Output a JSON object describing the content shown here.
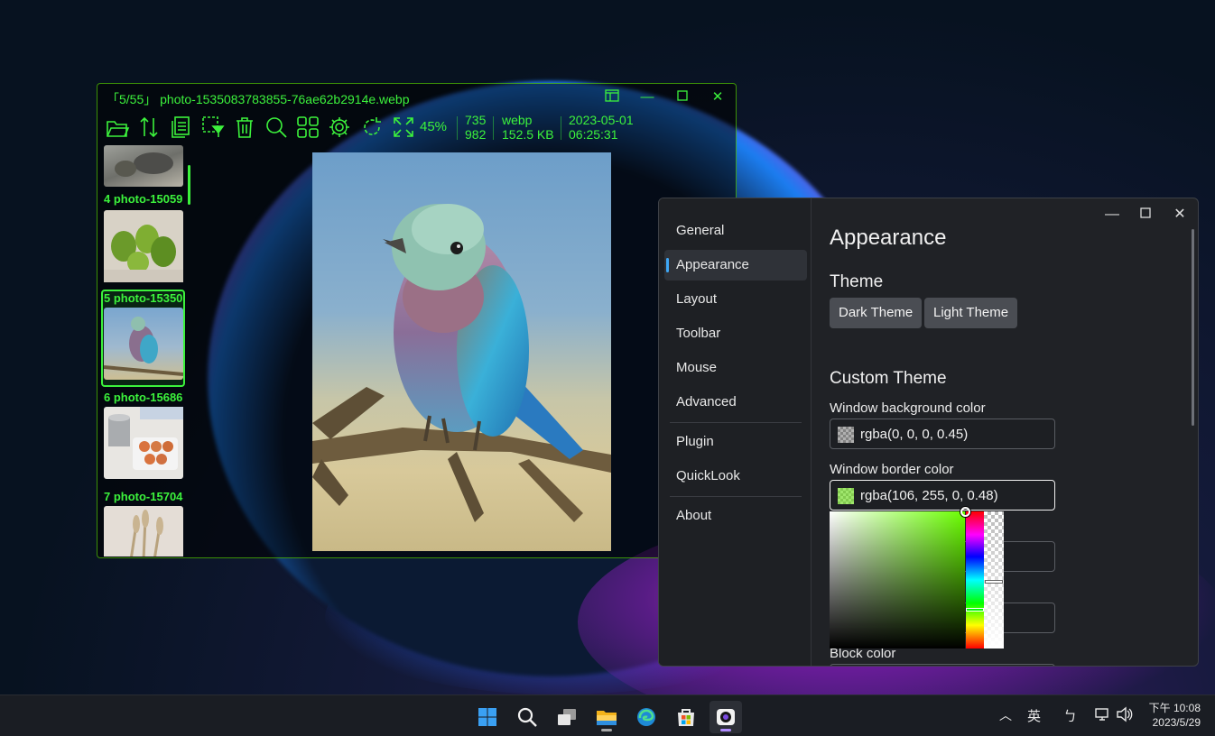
{
  "viewer": {
    "title": "「5/55」 photo-1535083783855-76ae62b2914e.webp",
    "zoom": "45%",
    "width": "735",
    "height": "982",
    "format": "webp",
    "filesize": "152.5 KB",
    "date": "2023-05-01",
    "time": "06:25:31",
    "accent_color": "#3cf23c",
    "thumbnails": [
      {
        "label": "4 photo-15059"
      },
      {
        "label": "5 photo-15350"
      },
      {
        "label": "6 photo-15686"
      },
      {
        "label": "7 photo-15704"
      }
    ]
  },
  "settings": {
    "nav": [
      "General",
      "Appearance",
      "Layout",
      "Toolbar",
      "Mouse",
      "Advanced",
      "Plugin",
      "QuickLook",
      "About"
    ],
    "active_nav": "Appearance",
    "page_title": "Appearance",
    "theme_heading": "Theme",
    "dark_theme": "Dark Theme",
    "light_theme": "Light Theme",
    "custom_heading": "Custom Theme",
    "bg_label": "Window background color",
    "bg_value": "rgba(0, 0, 0, 0.45)",
    "border_label": "Window border color",
    "border_value": "rgba(106, 255, 0, 0.48)",
    "block_label": "Block color",
    "picker_color": "#6aff00"
  },
  "taskbar": {
    "ime": "英",
    "time": "下午 10:08",
    "date": "2023/5/29"
  }
}
